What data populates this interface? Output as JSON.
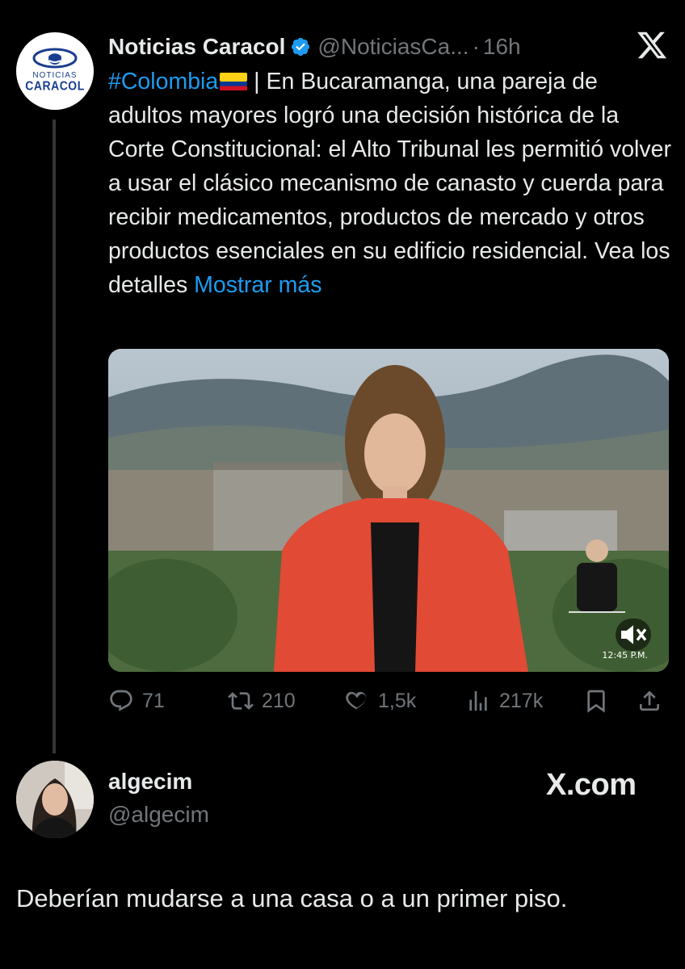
{
  "tweet": {
    "author_name": "Noticias Caracol",
    "author_handle": "@NoticiasCa...",
    "separator": "·",
    "time": "16h",
    "avatar_brand_top": "NOTICIAS",
    "avatar_brand_bottom": "CARACOL",
    "hashtag": "#Colombia",
    "text_body": " | En Bucaramanga, una pareja de adultos mayores logró una decisión histórica de la Corte Constitucional: el Alto Tribunal les permitió volver a usar el clásico mecanismo de canasto y cuerda para recibir medicamentos, productos de mercado y otros productos esenciales en su edificio residencial. Vea los detalles ",
    "show_more": "Mostrar más",
    "media_timestamp": "12:45 P.M.",
    "stats": {
      "replies": "71",
      "retweets": "210",
      "likes": "1,5k",
      "views": "217k"
    }
  },
  "reply": {
    "author_name": "algecim",
    "author_handle": "@algecim",
    "watermark": "X.com",
    "text": "Deberían mudarse a una casa o a un primer piso."
  },
  "colors": {
    "background": "#000000",
    "text": "#e7e9ea",
    "muted": "#71767b",
    "link": "#1d9bf0",
    "verified": "#1d9bf0"
  },
  "icons": [
    "verified-badge-icon",
    "x-logo-icon",
    "colombia-flag-icon",
    "reply-icon",
    "retweet-icon",
    "like-icon",
    "views-icon",
    "bookmark-icon",
    "share-icon",
    "mute-icon"
  ]
}
